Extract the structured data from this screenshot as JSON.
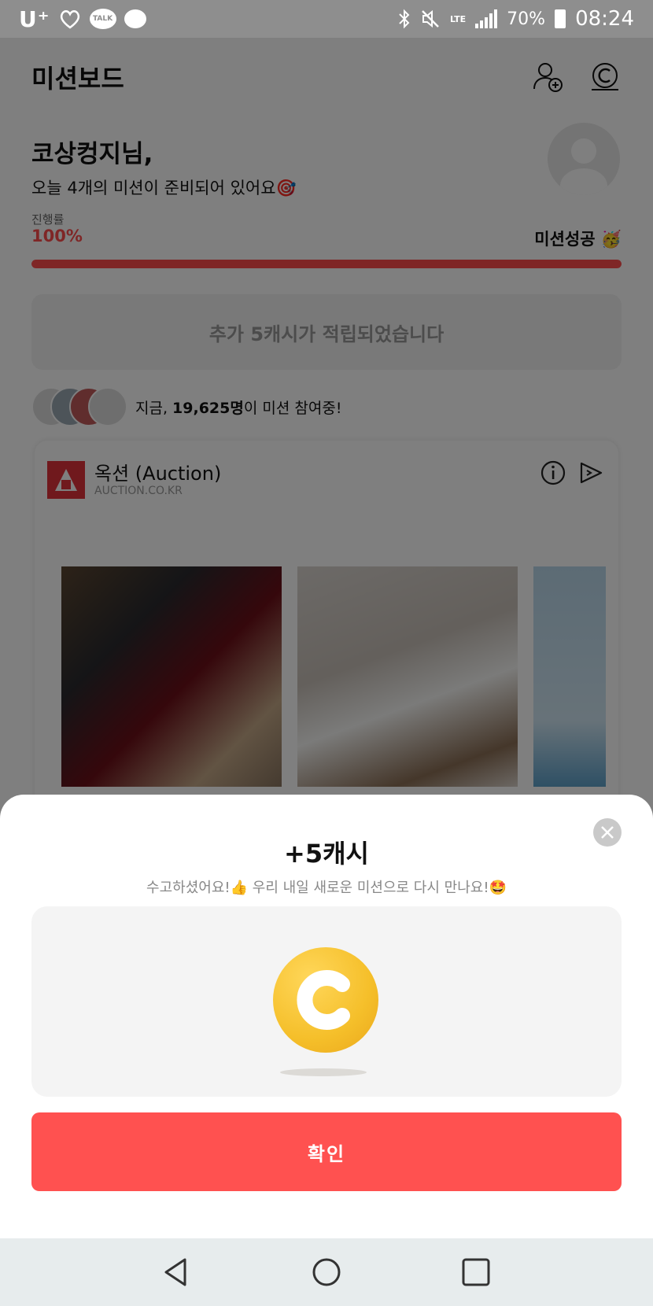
{
  "status_bar": {
    "carrier": "U⁺",
    "talk_label": "TALK",
    "battery": "70%",
    "network": "LTE",
    "time": "08:24"
  },
  "header": {
    "title": "미션보드",
    "icons": [
      "add-friend-icon",
      "cash-icon"
    ]
  },
  "greeting": {
    "name": "코상컹지님,",
    "subtitle": "오늘 4개의 미션이 준비되어 있어요🎯"
  },
  "progress": {
    "label": "진행률",
    "value_text": "100%",
    "value": 1.0,
    "status": "미션성공 🥳"
  },
  "reward_notice": "추가 5캐시가 적립되었습니다",
  "participants": {
    "prefix": "지금, ",
    "count": "19,625명",
    "suffix": "이 미션 참여중!"
  },
  "card": {
    "name": "옥션 (Auction)",
    "domain": "AUCTION.CO.KR",
    "icons": [
      "info-icon",
      "share-icon"
    ]
  },
  "sheet": {
    "title": "+5캐시",
    "subtitle": "수고하셨어요!👍 우리 내일 새로운 미션으로 다시 만나요!🤩",
    "confirm_label": "확인"
  },
  "navbar": {
    "icons": [
      "back-icon",
      "home-icon",
      "recents-icon"
    ]
  },
  "colors": {
    "accent": "#ff5150",
    "coin": "#f5bf2a",
    "progress": "#ff4d4d"
  }
}
